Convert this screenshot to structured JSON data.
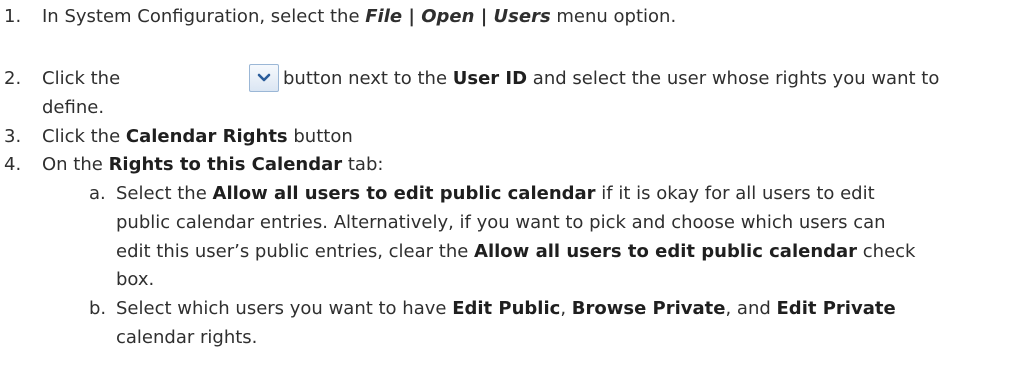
{
  "steps": {
    "s1": {
      "num": "1.",
      "pre": "In System Configuration, select the ",
      "menu": "File | Open | Users",
      "post": " menu option."
    },
    "s2": {
      "num": "2.",
      "pre": "Click the ",
      "mid": " button next to the ",
      "userid": "User ID",
      "post": " and select the user whose rights you want to",
      "cont": "define."
    },
    "s3": {
      "num": "3.",
      "pre": "Click the ",
      "button": "Calendar Rights",
      "post": " button"
    },
    "s4": {
      "num": "4.",
      "pre": "On the ",
      "tab": "Rights to this Calendar",
      "post": " tab:"
    },
    "sa": {
      "letter": "a.",
      "l1_pre": "Select the ",
      "l1_bold": "Allow all users to edit public calendar",
      "l1_post": " if it is okay for all users to edit",
      "l2": "public calendar entries. Alternatively, if you want to pick and choose which users can",
      "l3_pre": "edit this user’s public entries, clear the ",
      "l3_bold": "Allow all users to edit public calendar",
      "l3_post": " check",
      "l4": "box."
    },
    "sb": {
      "letter": "b.",
      "l1_pre": "Select which users you want to have ",
      "b1": "Edit Public",
      "sep1": ", ",
      "b2": "Browse Private",
      "sep2": ", and ",
      "b3": "Edit Private",
      "l2": "calendar rights."
    }
  },
  "icons": {
    "dropdown_button": "chevron-down-icon"
  }
}
